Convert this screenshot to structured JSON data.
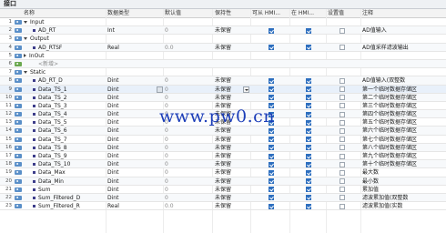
{
  "panel_title": "接口",
  "columns": {
    "name": "名称",
    "data_type": "数据类型",
    "default_value": "默认值",
    "retain": "保持性",
    "hmi_access": "可从 HMI...",
    "hmi_visible": "在 HMI...",
    "setpoint": "设置值",
    "comment": "注释"
  },
  "watermark": "www.pw0.cn",
  "rows": [
    {
      "num": "1",
      "kind": "section",
      "expanded": true,
      "name": "Input",
      "type": "",
      "default": "",
      "retain": "",
      "hmi": null,
      "vis": null,
      "set": null,
      "comment": ""
    },
    {
      "num": "2",
      "kind": "var",
      "name": "AD_RT",
      "type": "Int",
      "default": "0",
      "retain": "未保留",
      "hmi": true,
      "vis": true,
      "set": false,
      "comment": "AD值输入"
    },
    {
      "num": "3",
      "kind": "section",
      "expanded": true,
      "name": "Output",
      "type": "",
      "default": "",
      "retain": "",
      "hmi": null,
      "vis": null,
      "set": null,
      "comment": ""
    },
    {
      "num": "4",
      "kind": "var",
      "name": "AD_RTSF",
      "type": "Real",
      "default": "0.0",
      "retain": "未保留",
      "hmi": true,
      "vis": true,
      "set": false,
      "comment": "AD值采样滤波输出"
    },
    {
      "num": "5",
      "kind": "section",
      "expanded": false,
      "name": "InOut",
      "type": "",
      "default": "",
      "retain": "",
      "hmi": null,
      "vis": null,
      "set": null,
      "comment": ""
    },
    {
      "num": "6",
      "kind": "placeholder",
      "name": "<新增>",
      "type": "",
      "default": "",
      "retain": "",
      "hmi": null,
      "vis": null,
      "set": null,
      "comment": ""
    },
    {
      "num": "7",
      "kind": "section",
      "expanded": true,
      "name": "Static",
      "type": "",
      "default": "",
      "retain": "",
      "hmi": null,
      "vis": null,
      "set": null,
      "comment": ""
    },
    {
      "num": "8",
      "kind": "var",
      "name": "AD_RT_D",
      "type": "Dint",
      "default": "0",
      "retain": "未保留",
      "hmi": true,
      "vis": true,
      "set": false,
      "comment": "AD值输入(双整数"
    },
    {
      "num": "9",
      "kind": "var",
      "name": "Data_TS_1",
      "type": "Dint",
      "default": "0",
      "retain": "未保留",
      "hmi": true,
      "vis": true,
      "set": false,
      "comment": "第一个临时数据存储区",
      "selected": true
    },
    {
      "num": "10",
      "kind": "var",
      "name": "Data_TS_2",
      "type": "Dint",
      "default": "0",
      "retain": "未保留",
      "hmi": true,
      "vis": true,
      "set": false,
      "comment": "第二个临时数据存储区"
    },
    {
      "num": "11",
      "kind": "var",
      "name": "Data_TS_3",
      "type": "Dint",
      "default": "0",
      "retain": "未保留",
      "hmi": true,
      "vis": true,
      "set": false,
      "comment": "第三个临时数据存储区"
    },
    {
      "num": "12",
      "kind": "var",
      "name": "Data_TS_4",
      "type": "Dint",
      "default": "0",
      "retain": "未保留",
      "hmi": true,
      "vis": true,
      "set": false,
      "comment": "第四个临时数据存储区"
    },
    {
      "num": "13",
      "kind": "var",
      "name": "Data_TS_5",
      "type": "Dint",
      "default": "0",
      "retain": "未保留",
      "hmi": true,
      "vis": true,
      "set": false,
      "comment": "第五个临时数据存储区"
    },
    {
      "num": "14",
      "kind": "var",
      "name": "Data_TS_6",
      "type": "Dint",
      "default": "0",
      "retain": "未保留",
      "hmi": true,
      "vis": true,
      "set": false,
      "comment": "第六个临时数据存储区"
    },
    {
      "num": "15",
      "kind": "var",
      "name": "Data_TS_7",
      "type": "Dint",
      "default": "0",
      "retain": "未保留",
      "hmi": true,
      "vis": true,
      "set": false,
      "comment": "第七个临时数据存储区"
    },
    {
      "num": "16",
      "kind": "var",
      "name": "Data_TS_8",
      "type": "Dint",
      "default": "0",
      "retain": "未保留",
      "hmi": true,
      "vis": true,
      "set": false,
      "comment": "第八个临时数据存储区"
    },
    {
      "num": "17",
      "kind": "var",
      "name": "Data_TS_9",
      "type": "Dint",
      "default": "0",
      "retain": "未保留",
      "hmi": true,
      "vis": true,
      "set": false,
      "comment": "第九个临时数据存储区"
    },
    {
      "num": "18",
      "kind": "var",
      "name": "Data_TS_10",
      "type": "Dint",
      "default": "0",
      "retain": "未保留",
      "hmi": true,
      "vis": true,
      "set": false,
      "comment": "第十个临时数据存储区"
    },
    {
      "num": "19",
      "kind": "var",
      "name": "Data_Max",
      "type": "Dint",
      "default": "0",
      "retain": "未保留",
      "hmi": true,
      "vis": true,
      "set": false,
      "comment": "最大数"
    },
    {
      "num": "20",
      "kind": "var",
      "name": "Data_Min",
      "type": "Dint",
      "default": "0",
      "retain": "未保留",
      "hmi": true,
      "vis": true,
      "set": false,
      "comment": "最小数"
    },
    {
      "num": "21",
      "kind": "var",
      "name": "Sum",
      "type": "Dint",
      "default": "0",
      "retain": "未保留",
      "hmi": true,
      "vis": true,
      "set": false,
      "comment": "累加值"
    },
    {
      "num": "22",
      "kind": "var",
      "name": "Sum_Filtered_D",
      "type": "Dint",
      "default": "0",
      "retain": "未保留",
      "hmi": true,
      "vis": true,
      "set": false,
      "comment": "滤波累加值(双整数"
    },
    {
      "num": "23",
      "kind": "var",
      "name": "Sum_Filtered_R",
      "type": "Real",
      "default": "0.0",
      "retain": "未保留",
      "hmi": true,
      "vis": true,
      "set": false,
      "comment": "滤波累加值(实数"
    }
  ],
  "colors": {
    "accent": "#2e6fbf",
    "icon_blue": "#5a8fc8",
    "watermark": "#1b3db8"
  }
}
